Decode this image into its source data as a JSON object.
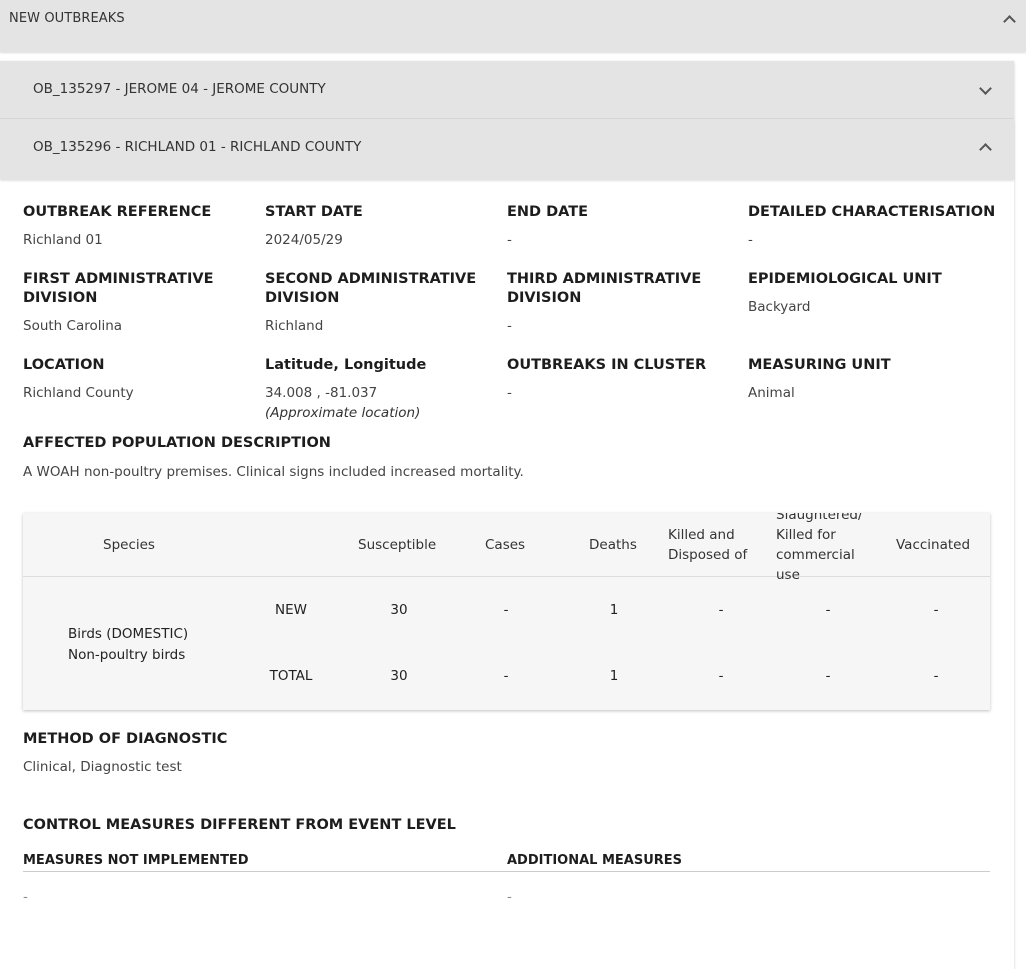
{
  "section": {
    "title": "NEW OUTBREAKS"
  },
  "outbreaks": [
    {
      "title": "OB_135297 - JEROME 04 - JEROME COUNTY"
    },
    {
      "title": "OB_135296 - RICHLAND 01 - RICHLAND COUNTY"
    }
  ],
  "details": {
    "outbreak_reference": {
      "label": "OUTBREAK REFERENCE",
      "value": "Richland 01"
    },
    "start_date": {
      "label": "START DATE",
      "value": "2024/05/29"
    },
    "end_date": {
      "label": "END DATE",
      "value": "-"
    },
    "detailed_characterisation": {
      "label": "DETAILED CHARACTERISATION",
      "value": "-"
    },
    "first_admin": {
      "label_line1": "FIRST ADMINISTRATIVE",
      "label_line2": "DIVISION",
      "value": "South Carolina"
    },
    "second_admin": {
      "label_line1": "SECOND ADMINISTRATIVE",
      "label_line2": "DIVISION",
      "value": "Richland"
    },
    "third_admin": {
      "label_line1": "THIRD ADMINISTRATIVE",
      "label_line2": "DIVISION",
      "value": "-"
    },
    "epi_unit": {
      "label": "EPIDEMIOLOGICAL UNIT",
      "value": "Backyard"
    },
    "location": {
      "label": "LOCATION",
      "value": "Richland County"
    },
    "lat_long": {
      "label": "Latitude, Longitude",
      "value": "34.008 , -81.037",
      "note": "(Approximate location)"
    },
    "outbreaks_in_cluster": {
      "label": "OUTBREAKS IN CLUSTER",
      "value": "-"
    },
    "measuring_unit": {
      "label": "MEASURING UNIT",
      "value": "Animal"
    },
    "affected_population": {
      "label": "AFFECTED POPULATION DESCRIPTION",
      "value": "A WOAH non-poultry premises. Clinical signs included increased mortality."
    }
  },
  "table": {
    "headers": {
      "species": "Species",
      "susceptible": "Susceptible",
      "cases": "Cases",
      "deaths": "Deaths",
      "killed_line1": "Killed and",
      "killed_line2": "Disposed of",
      "slaughtered_line1": "Slaughtered/",
      "slaughtered_line2": "Killed for",
      "slaughtered_line3": "commercial",
      "slaughtered_line4": "use",
      "vaccinated": "Vaccinated"
    },
    "species_line1": "Birds (DOMESTIC)",
    "species_line2": "Non-poultry birds",
    "rows": [
      {
        "label": "NEW",
        "susceptible": "30",
        "cases": "-",
        "deaths": "1",
        "killed": "-",
        "slaughtered": "-",
        "vaccinated": "-"
      },
      {
        "label": "TOTAL",
        "susceptible": "30",
        "cases": "-",
        "deaths": "1",
        "killed": "-",
        "slaughtered": "-",
        "vaccinated": "-"
      }
    ]
  },
  "diagnostic": {
    "label": "METHOD OF DIAGNOSTIC",
    "value": "Clinical, Diagnostic test"
  },
  "control": {
    "title": "CONTROL MEASURES DIFFERENT FROM EVENT LEVEL",
    "not_implemented": {
      "label": "MEASURES NOT IMPLEMENTED",
      "value": "-"
    },
    "additional": {
      "label": "ADDITIONAL MEASURES",
      "value": "-"
    }
  }
}
